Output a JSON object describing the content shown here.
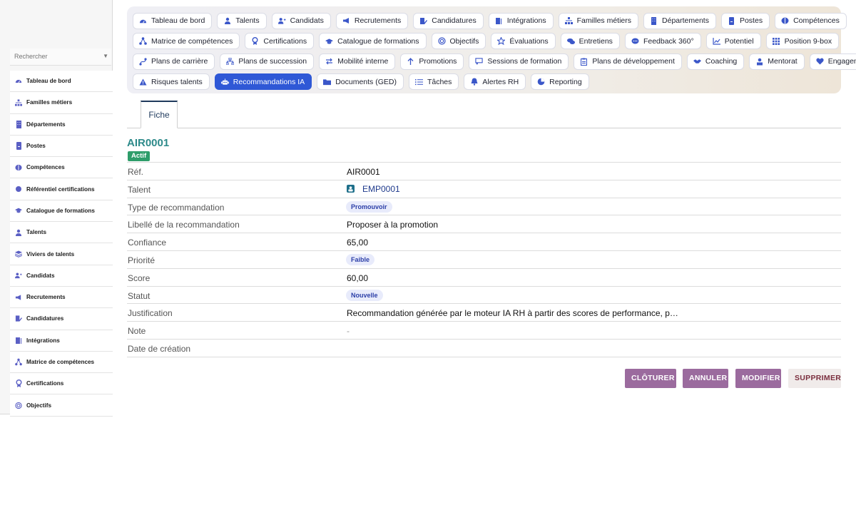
{
  "sidebar": {
    "search_placeholder": "Rechercher",
    "items": [
      {
        "label": "Tableau de bord",
        "icon": "dashboard-icon"
      },
      {
        "label": "Familles métiers",
        "icon": "hierarchy-icon"
      },
      {
        "label": "Départements",
        "icon": "building-icon"
      },
      {
        "label": "Postes",
        "icon": "badge-icon"
      },
      {
        "label": "Compétences",
        "icon": "brain-icon"
      },
      {
        "label": "Référentiel certifications",
        "icon": "certificate-icon"
      },
      {
        "label": "Catalogue de formations",
        "icon": "graduation-icon"
      },
      {
        "label": "Talents",
        "icon": "user-icon"
      },
      {
        "label": "Viviers de talents",
        "icon": "layers-icon"
      },
      {
        "label": "Candidats",
        "icon": "user-plus-icon"
      },
      {
        "label": "Recrutements",
        "icon": "megaphone-icon"
      },
      {
        "label": "Candidatures",
        "icon": "file-pen-icon"
      },
      {
        "label": "Intégrations",
        "icon": "door-icon"
      },
      {
        "label": "Matrice de compétences",
        "icon": "network-icon"
      },
      {
        "label": "Certifications",
        "icon": "award-icon"
      },
      {
        "label": "Objectifs",
        "icon": "target-icon"
      }
    ]
  },
  "topnav": {
    "rows": [
      [
        {
          "label": "Tableau de bord",
          "icon": "dashboard-icon"
        },
        {
          "label": "Talents",
          "icon": "user-icon"
        },
        {
          "label": "Candidats",
          "icon": "user-plus-icon"
        },
        {
          "label": "Recrutements",
          "icon": "megaphone-icon"
        },
        {
          "label": "Candidatures",
          "icon": "file-pen-icon"
        },
        {
          "label": "Intégrations",
          "icon": "door-icon"
        },
        {
          "label": "Familles métiers",
          "icon": "hierarchy-icon"
        },
        {
          "label": "Départements",
          "icon": "building-icon"
        },
        {
          "label": "Postes",
          "icon": "badge-icon"
        },
        {
          "label": "Compétences",
          "icon": "brain-icon"
        }
      ],
      [
        {
          "label": "Matrice de compétences",
          "icon": "network-icon"
        },
        {
          "label": "Certifications",
          "icon": "award-icon"
        },
        {
          "label": "Catalogue de formations",
          "icon": "graduation-icon"
        },
        {
          "label": "Objectifs",
          "icon": "target-icon"
        },
        {
          "label": "Évaluations",
          "icon": "star-icon"
        },
        {
          "label": "Entretiens",
          "icon": "comments-icon"
        },
        {
          "label": "Feedback 360°",
          "icon": "comment-icon"
        },
        {
          "label": "Potentiel",
          "icon": "chart-line-icon"
        },
        {
          "label": "Position 9-box",
          "icon": "grid-icon"
        }
      ],
      [
        {
          "label": "Plans de carrière",
          "icon": "route-icon"
        },
        {
          "label": "Plans de succession",
          "icon": "sitemap-icon"
        },
        {
          "label": "Mobilité interne",
          "icon": "swap-icon"
        },
        {
          "label": "Promotions",
          "icon": "arrow-up-icon"
        },
        {
          "label": "Sessions de formation",
          "icon": "presentation-icon"
        },
        {
          "label": "Plans de développement",
          "icon": "clipboard-icon"
        },
        {
          "label": "Coaching",
          "icon": "handshake-icon"
        },
        {
          "label": "Mentorat",
          "icon": "mentor-icon"
        },
        {
          "label": "Engagement",
          "icon": "heart-icon"
        }
      ],
      [
        {
          "label": "Risques talents",
          "icon": "warning-icon"
        },
        {
          "label": "Recommandations IA",
          "icon": "robot-icon",
          "active": true
        },
        {
          "label": "Documents (GED)",
          "icon": "folder-icon"
        },
        {
          "label": "Tâches",
          "icon": "list-icon"
        },
        {
          "label": "Alertes RH",
          "icon": "bell-icon"
        },
        {
          "label": "Reporting",
          "icon": "pie-icon"
        }
      ]
    ]
  },
  "tabs": {
    "fiche": "Fiche"
  },
  "record": {
    "title": "AIR0001",
    "status_badge": "Actif",
    "fields": {
      "ref": {
        "label": "Réf.",
        "value": "AIR0001"
      },
      "talent": {
        "label": "Talent",
        "value": "EMP0001"
      },
      "type": {
        "label": "Type de recommandation",
        "value": "Promouvoir"
      },
      "libelle": {
        "label": "Libellé de la recommandation",
        "value": "Proposer à la promotion"
      },
      "confiance": {
        "label": "Confiance",
        "value": "65,00"
      },
      "priorite": {
        "label": "Priorité",
        "value": "Faible"
      },
      "score": {
        "label": "Score",
        "value": "60,00"
      },
      "statut": {
        "label": "Statut",
        "value": "Nouvelle"
      },
      "justification": {
        "label": "Justification",
        "value": "Recommandation générée par le moteur IA RH à partir des scores de performance, p…"
      },
      "note": {
        "label": "Note",
        "value": "-"
      },
      "date_creation": {
        "label": "Date de création",
        "value": ""
      }
    }
  },
  "actions": {
    "cloturer": "CLÔTURER",
    "annuler": "ANNULER",
    "modifier": "MODIFIER",
    "supprimer": "SUPPRIMER"
  }
}
